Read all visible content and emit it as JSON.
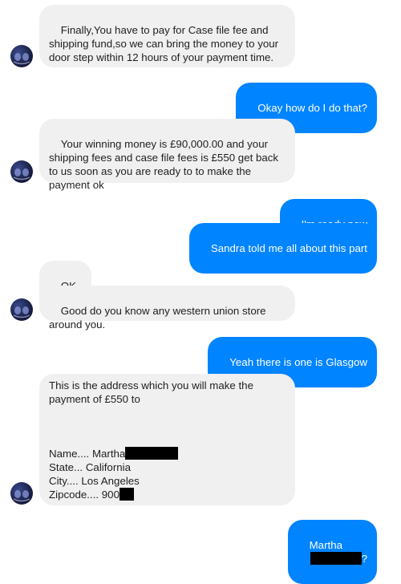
{
  "messages": [
    {
      "id": "m1",
      "from": "them",
      "text": "Finally,You have to pay for Case file fee and shipping fund,so we can bring the money to your door step within 12 hours of your payment time."
    },
    {
      "id": "m2",
      "from": "me",
      "text": "Okay how do I do that?"
    },
    {
      "id": "m3",
      "from": "them",
      "text": "Your winning money is £90,000.00 and your shipping fees and case file fees is £550 get back to us soon as you are ready to to make the payment ok"
    },
    {
      "id": "m4",
      "from": "me",
      "text": "I'm ready now"
    },
    {
      "id": "m5",
      "from": "me",
      "text": "Sandra told me all about this part"
    },
    {
      "id": "m6",
      "from": "them",
      "text": "OK ."
    },
    {
      "id": "m7",
      "from": "them",
      "text": "Good do you know any western union store around you."
    },
    {
      "id": "m8",
      "from": "me",
      "text": "Yeah there is one is Glasgow"
    },
    {
      "id": "m9",
      "from": "them",
      "intro": "This is the address which you will make the payment of £550 to",
      "name_prefix": "Name.... Martha",
      "state": "State... California",
      "city": "City.... Los Angeles",
      "zip_prefix": "Zipcode.... 900"
    },
    {
      "id": "m10",
      "from": "me",
      "prefix": "Martha",
      "suffix": "?"
    }
  ],
  "colors": {
    "incoming_bubble": "#f1f0f0",
    "outgoing_bubble": "#0084ff",
    "redaction": "#000000"
  },
  "icons": {
    "avatar": "contact-avatar-icon"
  }
}
